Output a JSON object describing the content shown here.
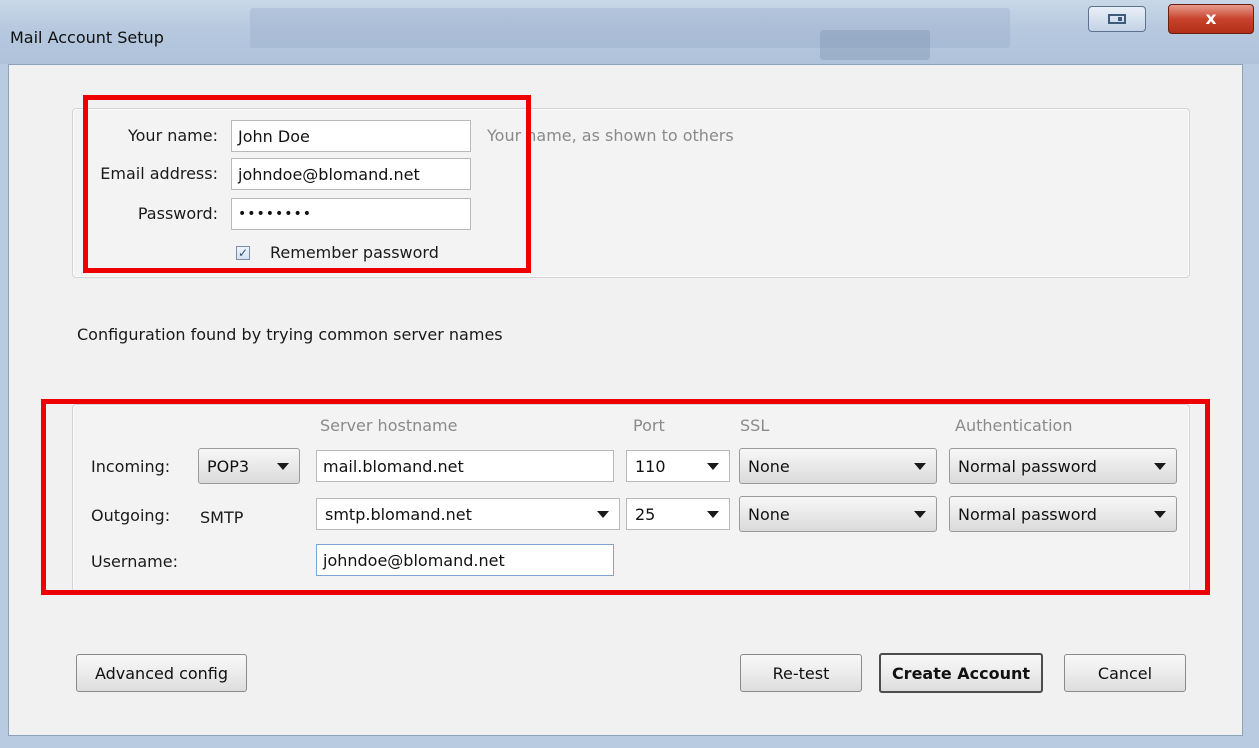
{
  "window": {
    "title": "Mail Account Setup",
    "close_glyph": "x",
    "restore_icon": "restore-window-icon"
  },
  "identity": {
    "name_label": "Your name:",
    "name_value": "John Doe",
    "name_hint": "Your name, as shown to others",
    "email_label": "Email address:",
    "email_value": "johndoe@blomand.net",
    "password_label": "Password:",
    "password_mask": "••••••••",
    "remember_label": "Remember password",
    "remember_checked": true,
    "check_glyph": "✓"
  },
  "status_message": "Configuration found by trying common server names",
  "server_table": {
    "headers": {
      "hostname": "Server hostname",
      "port": "Port",
      "ssl": "SSL",
      "auth": "Authentication"
    },
    "incoming": {
      "label": "Incoming:",
      "protocol": "POP3",
      "hostname": "mail.blomand.net",
      "port": "110",
      "ssl": "None",
      "auth": "Normal password"
    },
    "outgoing": {
      "label": "Outgoing:",
      "protocol": "SMTP",
      "hostname": "smtp.blomand.net",
      "port": "25",
      "ssl": "None",
      "auth": "Normal password"
    },
    "username": {
      "label": "Username:",
      "value": "johndoe@blomand.net"
    }
  },
  "buttons": {
    "advanced": "Advanced config",
    "retest": "Re-test",
    "create": "Create Account",
    "cancel": "Cancel"
  },
  "colors": {
    "highlight_box": "#ee0000",
    "title_bar": "#b7c9df",
    "close_button": "#c8432b"
  }
}
